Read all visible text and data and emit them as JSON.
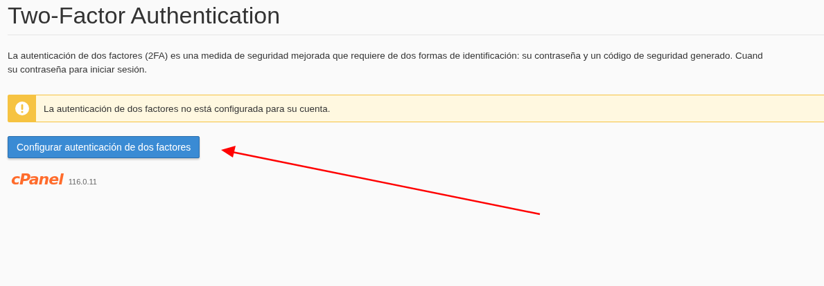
{
  "title": "Two-Factor Authentication",
  "description": "La autenticación de dos factores (2FA) es una medida de seguridad mejorada que requiere de dos formas de identificación: su contraseña y un código de seguridad generado. Cuand\nsu contraseña para iniciar sesión.",
  "alert": {
    "kind": "warning",
    "message": "La autenticación de dos factores no está configurada para su cuenta."
  },
  "button": "Configurar autenticación de dos factores",
  "footer": {
    "logo": "cPanel",
    "version": "116.0.11"
  }
}
